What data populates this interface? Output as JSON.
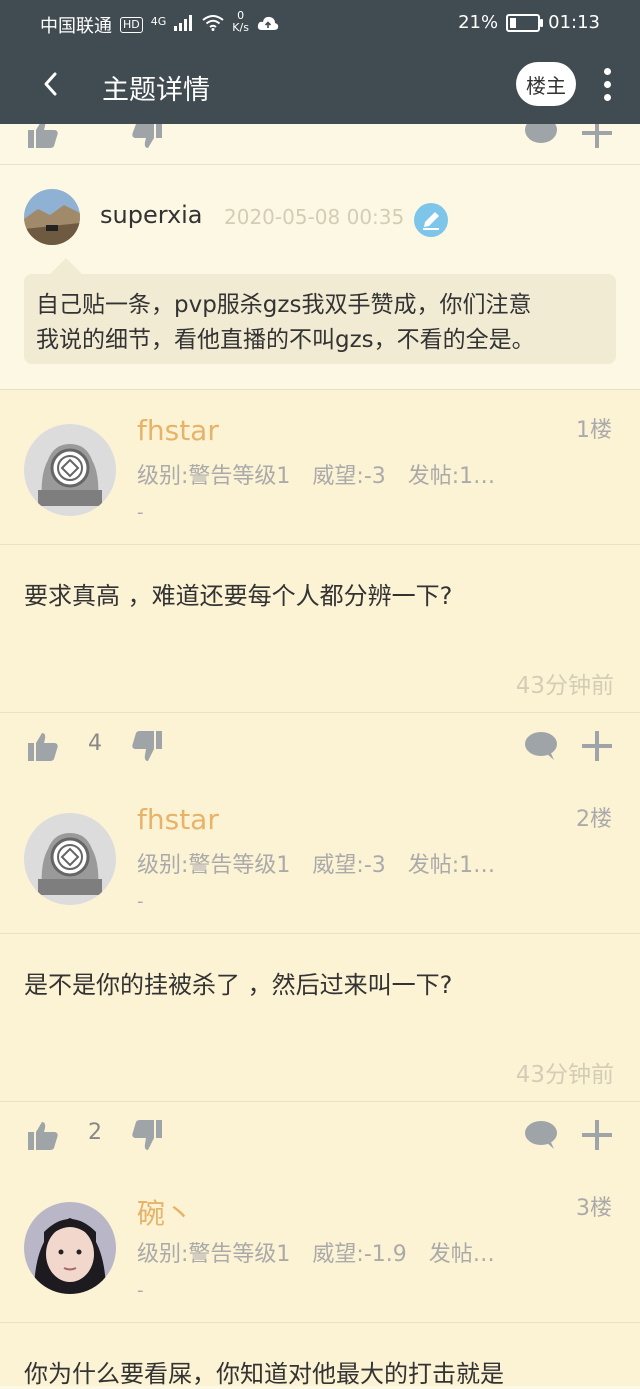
{
  "status_bar": {
    "carrier": "中国联通",
    "hd": "HD",
    "network": "4G",
    "speed_value": "0",
    "speed_unit": "K/s",
    "battery": "21%",
    "battery_level": 0.21,
    "time": "01:13"
  },
  "topbar": {
    "title": "主题详情",
    "owner_button": "楼主"
  },
  "main_post": {
    "author": "superxia",
    "timestamp": "2020-05-08 00:35",
    "text_line1": "自己贴一条，pvp服杀gzs我双手赞成，你们注意",
    "text_line2": "我说的细节，看他直播的不叫gzs，不看的全是。"
  },
  "replies": [
    {
      "name": "fhstar",
      "floor": "1楼",
      "meta": "级别:警告等级1　威望:-3　发帖:1…",
      "dash": "-",
      "content": "要求真高 ，难道还要每个人都分辨一下?",
      "time": "43分钟前",
      "likes": "4"
    },
    {
      "name": "fhstar",
      "floor": "2楼",
      "meta": "级别:警告等级1　威望:-3　发帖:1…",
      "dash": "-",
      "content": "是不是你的挂被杀了 ，然后过来叫一下?",
      "time": "43分钟前",
      "likes": "2"
    },
    {
      "name": "碗丶",
      "floor": "3楼",
      "meta": "级别:警告等级1　威望:-1.9　发帖…",
      "dash": "-",
      "content": "你为什么要看屎，你知道对他最大的打击就是"
    }
  ],
  "colors": {
    "header_bg": "#414b52",
    "page_bg": "#fdf8e4",
    "reply_bg": "#fcf3d4",
    "username_orange": "#e7b36a",
    "edit_icon_blue": "#7ec5ea",
    "icon_gray": "#9ea4a8"
  }
}
